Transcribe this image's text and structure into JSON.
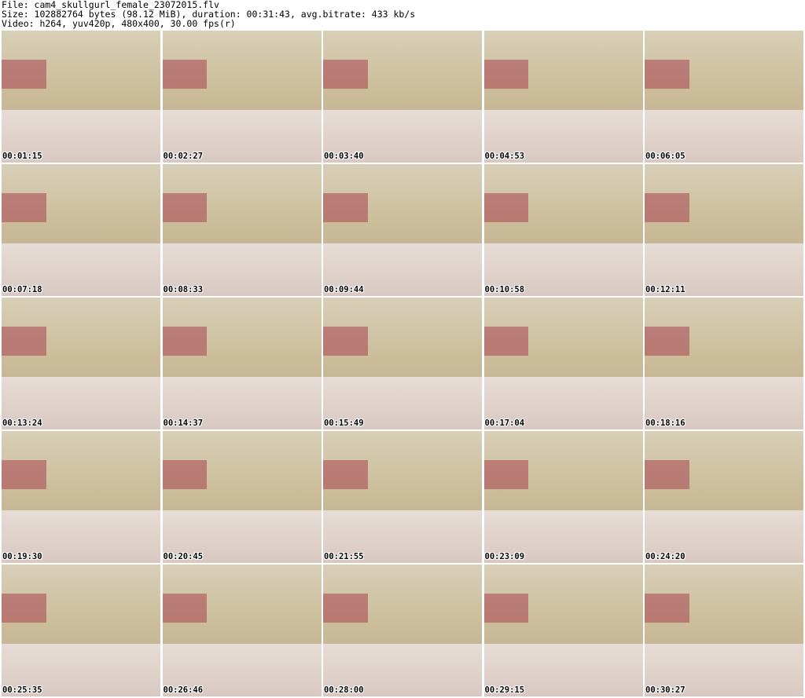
{
  "header": {
    "file_line": "File: cam4_skullgurl_female_23072015.flv",
    "size_line": "Size: 102882764 bytes (98.12 MiB), duration: 00:31:43, avg.bitrate: 433 kb/s",
    "video_line": "Video: h264, yuv420p, 480x400, 30.00 fps(r)"
  },
  "thumbnails": [
    {
      "timestamp": "00:01:15"
    },
    {
      "timestamp": "00:02:27"
    },
    {
      "timestamp": "00:03:40"
    },
    {
      "timestamp": "00:04:53"
    },
    {
      "timestamp": "00:06:05"
    },
    {
      "timestamp": "00:07:18"
    },
    {
      "timestamp": "00:08:33"
    },
    {
      "timestamp": "00:09:44"
    },
    {
      "timestamp": "00:10:58"
    },
    {
      "timestamp": "00:12:11"
    },
    {
      "timestamp": "00:13:24"
    },
    {
      "timestamp": "00:14:37"
    },
    {
      "timestamp": "00:15:49"
    },
    {
      "timestamp": "00:17:04"
    },
    {
      "timestamp": "00:18:16"
    },
    {
      "timestamp": "00:19:30"
    },
    {
      "timestamp": "00:20:45"
    },
    {
      "timestamp": "00:21:55"
    },
    {
      "timestamp": "00:23:09"
    },
    {
      "timestamp": "00:24:20"
    },
    {
      "timestamp": "00:25:35"
    },
    {
      "timestamp": "00:26:46"
    },
    {
      "timestamp": "00:28:00"
    },
    {
      "timestamp": "00:29:15"
    },
    {
      "timestamp": "00:30:27"
    }
  ]
}
